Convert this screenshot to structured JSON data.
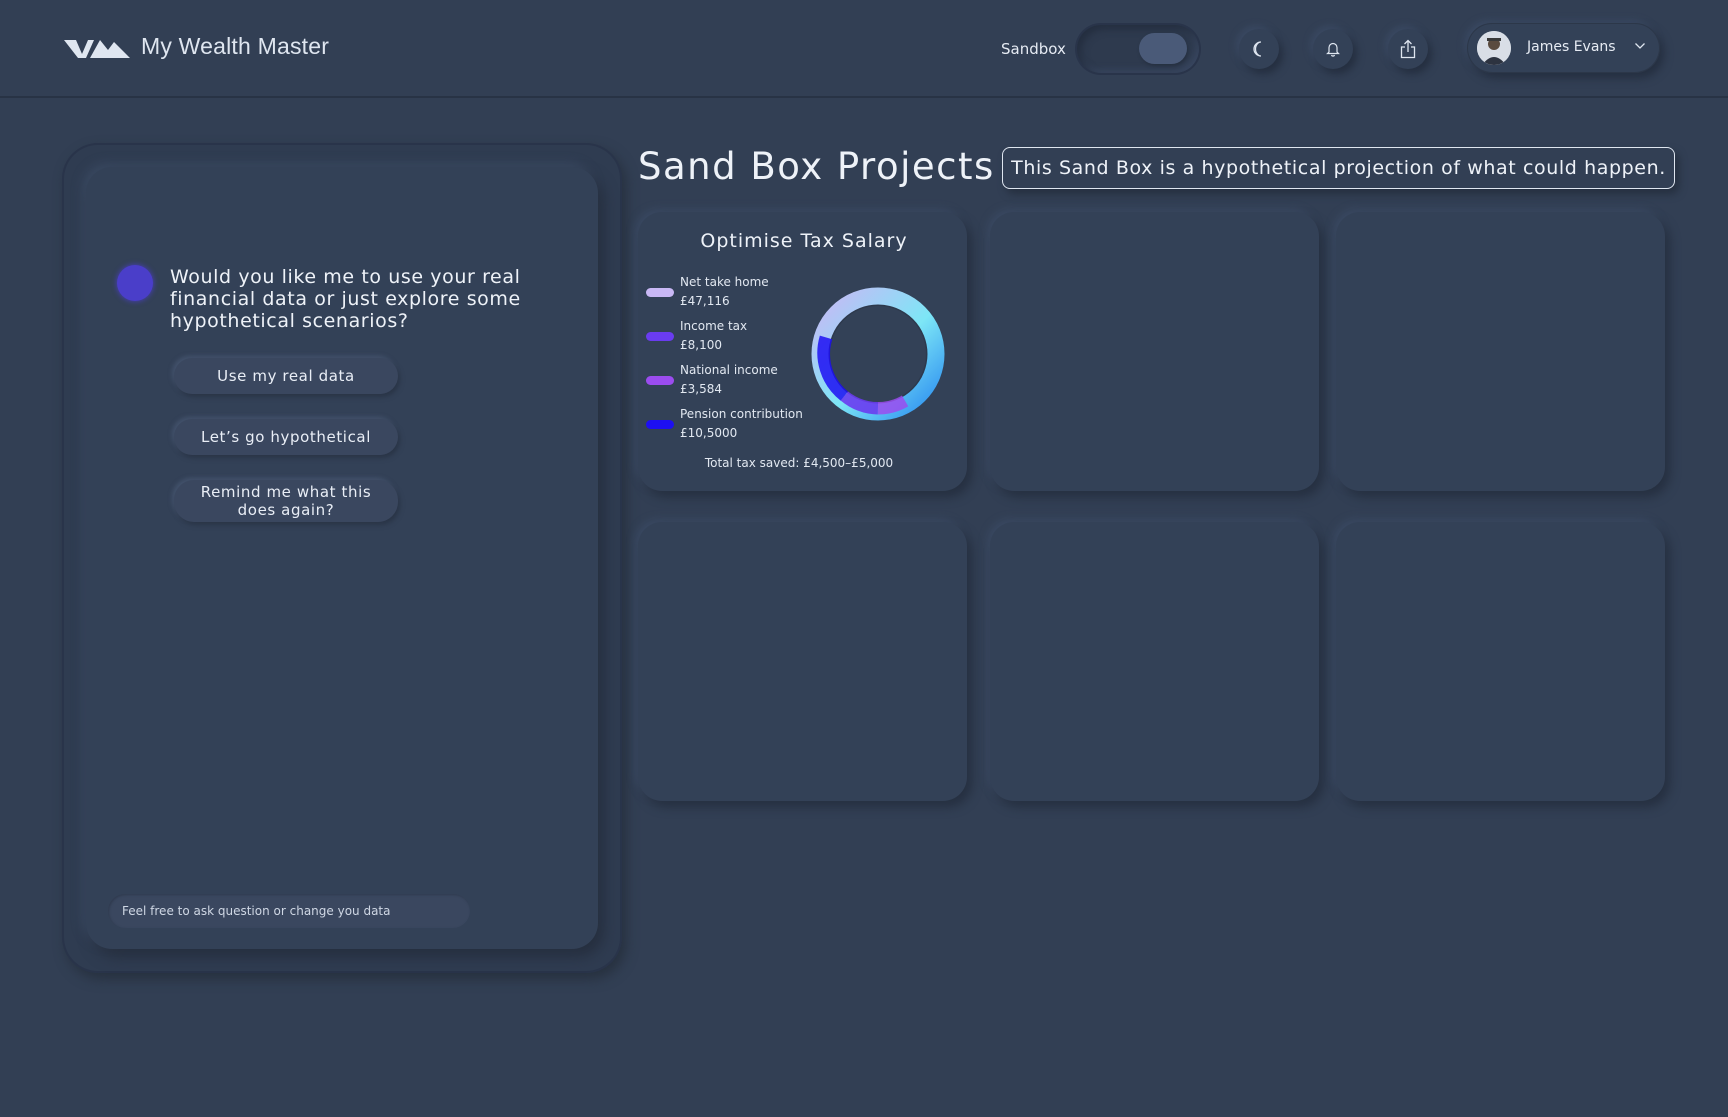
{
  "header": {
    "brand": "My Wealth Master",
    "sandbox_label": "Sandbox",
    "sandbox_on": true,
    "icons": [
      "moon-icon",
      "bell-icon",
      "share-icon"
    ],
    "user_name": "James Evans"
  },
  "chat": {
    "question": "Would you like me to use your real financial data or just explore some hypothetical scenarios?",
    "options": [
      "Use my real data",
      "Let’s go hypothetical",
      "Remind me what this does again?"
    ],
    "input_placeholder": "Feel free to ask question or change you data",
    "bot_color": "#4a3ec9"
  },
  "main": {
    "title": "Sand Box Projects",
    "notice": "This Sand Box is a hypothetical projection of what could happen."
  },
  "tax_card": {
    "title": "Optimise Tax Salary",
    "legend": [
      {
        "label": "Net take home",
        "value": "£47,116",
        "color": "#c9b8f5"
      },
      {
        "label": "Income tax",
        "value": "£8,100",
        "color": "#6a3cf0"
      },
      {
        "label": "National income",
        "value": "£3,584",
        "color": "#9b4cef"
      },
      {
        "label": "Pension contribution",
        "value": "£10,5000",
        "color": "#1d0ff2"
      }
    ],
    "total": "Total tax saved: £4,500–£5,000"
  },
  "colors": {
    "background": "#323f54",
    "card": "#334157",
    "accent": "#4a3ec9"
  }
}
